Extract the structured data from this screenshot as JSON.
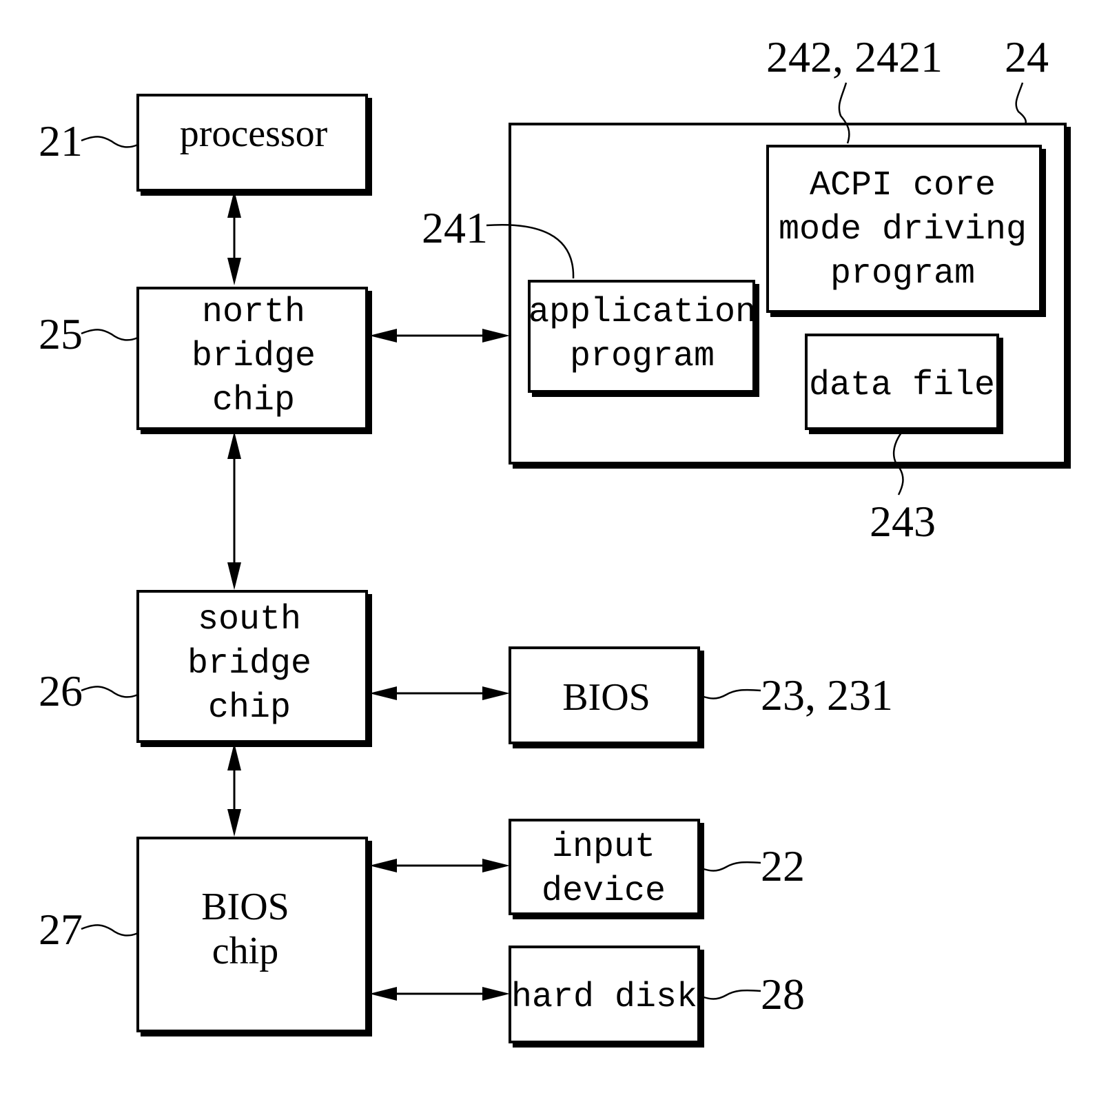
{
  "figure": {
    "type": "block-diagram",
    "blocks": {
      "processor": {
        "ref": "21",
        "lines": [
          "processor"
        ]
      },
      "north_bridge": {
        "ref": "25",
        "lines": [
          "north",
          "bridge",
          "chip"
        ]
      },
      "south_bridge": {
        "ref": "26",
        "lines": [
          "south",
          "bridge",
          "chip"
        ]
      },
      "bios_chip": {
        "ref": "27",
        "lines": [
          "BIOS",
          "chip"
        ]
      },
      "memory": {
        "ref": "24",
        "lines": []
      },
      "application_program": {
        "ref": "241",
        "lines": [
          "application",
          "program"
        ]
      },
      "acpi_driver": {
        "ref": "242, 2421",
        "lines": [
          "ACPI core",
          "mode driving",
          "program"
        ]
      },
      "data_file": {
        "ref": "243",
        "lines": [
          "data file"
        ]
      },
      "bios": {
        "ref": "23, 231",
        "lines": [
          "BIOS"
        ]
      },
      "input_device": {
        "ref": "22",
        "lines": [
          "input",
          "device"
        ]
      },
      "hard_disk": {
        "ref": "28",
        "lines": [
          "hard disk"
        ]
      }
    },
    "connections": [
      {
        "from": "processor",
        "to": "north_bridge",
        "type": "bidirectional"
      },
      {
        "from": "north_bridge",
        "to": "memory",
        "type": "bidirectional"
      },
      {
        "from": "north_bridge",
        "to": "south_bridge",
        "type": "bidirectional"
      },
      {
        "from": "south_bridge",
        "to": "bios",
        "type": "bidirectional"
      },
      {
        "from": "south_bridge",
        "to": "bios_chip",
        "type": "bidirectional"
      },
      {
        "from": "bios_chip",
        "to": "input_device",
        "type": "bidirectional"
      },
      {
        "from": "bios_chip",
        "to": "hard_disk",
        "type": "bidirectional"
      }
    ]
  }
}
